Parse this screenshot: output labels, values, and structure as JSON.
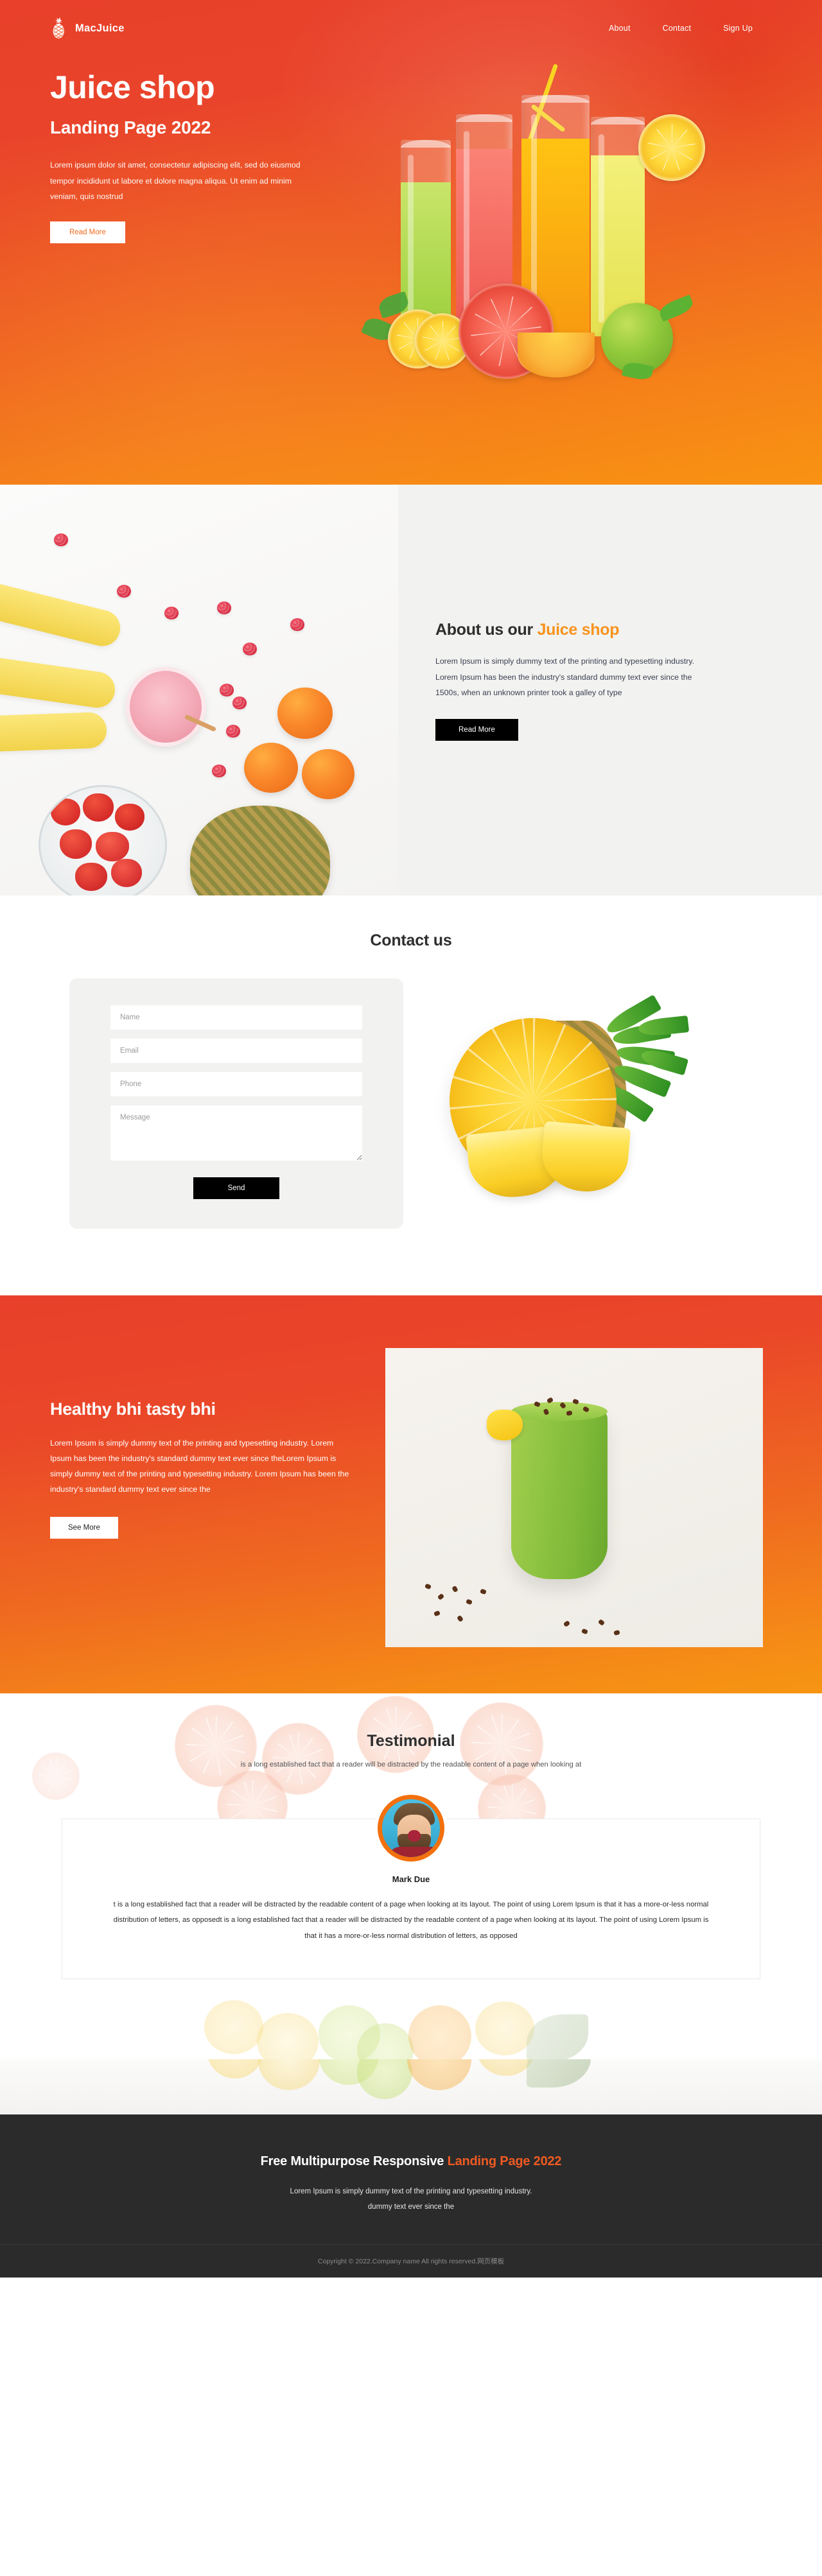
{
  "brand": {
    "name": "MacJuice",
    "logo_icon": "pineapple-icon"
  },
  "nav": {
    "items": [
      {
        "label": "About"
      },
      {
        "label": "Contact"
      },
      {
        "label": "Sign Up"
      }
    ]
  },
  "hero": {
    "title": "Juice shop",
    "subtitle": "Landing Page 2022",
    "body": "Lorem ipsum dolor sit amet, consectetur adipiscing elit, sed do eiusmod tempor incididunt ut labore et dolore magna aliqua. Ut enim ad minim veniam, quis nostrud",
    "cta": "Read More",
    "image_alt": "four-juice-glasses-with-citrus-fruit",
    "gradient_from": "#e8402a",
    "gradient_to": "#f99312"
  },
  "about": {
    "title_plain": "About us our ",
    "title_accent": "Juice shop",
    "body": "Lorem Ipsum is simply dummy text of the printing and typesetting industry. Lorem Ipsum has been the industry's standard dummy text ever since the 1500s, when an unknown printer took a galley of type",
    "cta": "Read More",
    "image_alt": "fruit-flatlay-bananas-berries-oranges-pineapple",
    "accent_color": "#f7931e",
    "bg_color": "#f2f2f0"
  },
  "contact": {
    "title": "Contact us",
    "fields": {
      "name_placeholder": "Name",
      "email_placeholder": "Email",
      "phone_placeholder": "Phone",
      "message_placeholder": "Message"
    },
    "values": {
      "name": "",
      "email": "",
      "phone": "",
      "message": ""
    },
    "submit": "Send",
    "image_alt": "pineapple-with-slices"
  },
  "healthy": {
    "title": "Healthy bhi tasty bhi",
    "body": "Lorem Ipsum is simply dummy text of the printing and typesetting industry. Lorem Ipsum has been the industry's standard dummy text ever since theLorem Ipsum is simply dummy text of the printing and typesetting industry. Lorem Ipsum has been the industry's standard dummy text ever since the",
    "cta": "See More",
    "image_alt": "green-smoothie-with-mango-and-cacao-nibs"
  },
  "testimonial": {
    "title": "Testimonial",
    "subtitle": "is a long established fact that a reader will be distracted by the readable content of a page when looking at",
    "author": "Mark Due",
    "avatar_alt": "laughing-man-portrait",
    "avatar_ring_color": "#f2700e",
    "quote": "t is a long established fact that a reader will be distracted by the readable content of a page when looking at its layout. The point of using Lorem Ipsum is that it has a more-or-less normal distribution of letters, as opposedt is a long established fact that a reader will be distracted by the readable content of a page when looking at its layout. The point of using Lorem Ipsum is that it has a more-or-less normal distribution of letters, as opposed"
  },
  "footer": {
    "title_plain": "Free Multipurpose Responsive ",
    "title_accent": "Landing Page 2022",
    "body_line1": "Lorem Ipsum is simply dummy text of the printing and typesetting industry.",
    "body_line2": "dummy text ever since the",
    "copyright_plain": "Copyright © 2022.Company name All rights reserved.",
    "copyright_link": "网页模板",
    "bg_color": "#2b2b2b",
    "accent_color": "#f05a22"
  }
}
